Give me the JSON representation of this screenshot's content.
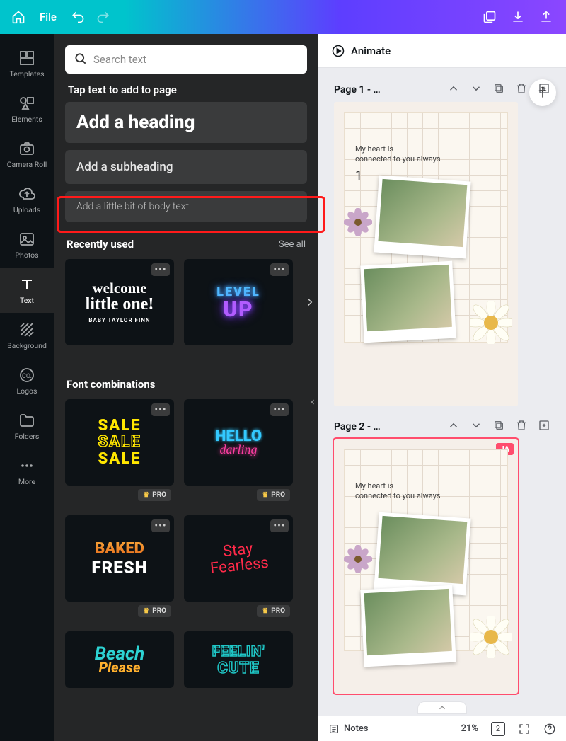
{
  "topbar": {
    "file_label": "File"
  },
  "sidebar": {
    "items": [
      {
        "label": "Templates"
      },
      {
        "label": "Elements"
      },
      {
        "label": "Camera Roll"
      },
      {
        "label": "Uploads"
      },
      {
        "label": "Photos"
      },
      {
        "label": "Text"
      },
      {
        "label": "Background"
      },
      {
        "label": "Logos"
      },
      {
        "label": "Folders"
      },
      {
        "label": "More"
      }
    ]
  },
  "panel": {
    "search_placeholder": "Search text",
    "tap_label": "Tap text to add to page",
    "heading": "Add a heading",
    "subheading": "Add a subheading",
    "body": "Add a little bit of body text",
    "recently_used": "Recently used",
    "see_all": "See all",
    "font_combinations": "Font combinations",
    "pro_label": "PRO",
    "recent_cards": [
      {
        "line1": "welcome",
        "line2": "little one!",
        "line3": "BABY TAYLOR FINN"
      },
      {
        "line1": "LEVEL",
        "line2": "UP"
      }
    ],
    "font_cards": [
      {
        "l1": "SALE",
        "l2": "SALE",
        "l3": "SALE",
        "pro": false
      },
      {
        "l1": "HELLO",
        "l2": "darling",
        "pro": false
      },
      {
        "l1": "BAKED",
        "l2": "FRESH",
        "pro": true
      },
      {
        "l1": "Stay",
        "l2": "Fearless",
        "pro": true
      },
      {
        "l1": "Beach",
        "l2": "Please",
        "pro": true
      },
      {
        "l1": "FEELIN'",
        "l2": "CUTE",
        "pro": true
      }
    ]
  },
  "canvas": {
    "animate_label": "Animate",
    "page1_label": "Page 1 - …",
    "page2_label": "Page 2 - …",
    "badge": "JA",
    "script_line1": "My heart is",
    "script_line2": "connected to you always",
    "script_num": "1"
  },
  "bottom": {
    "notes_label": "Notes",
    "zoom": "21%",
    "page_count": "2"
  }
}
